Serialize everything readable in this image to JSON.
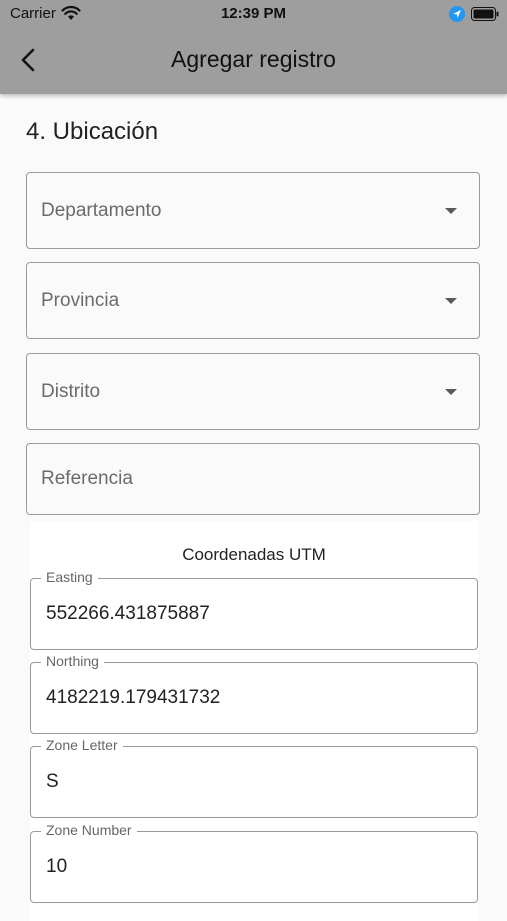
{
  "status_bar": {
    "carrier": "Carrier",
    "time": "12:39 PM"
  },
  "app_bar": {
    "title": "Agregar registro"
  },
  "section": {
    "title": "4. Ubicación"
  },
  "selects": {
    "departamento": "Departamento",
    "provincia": "Provincia",
    "distrito": "Distrito"
  },
  "referencia": {
    "placeholder": "Referencia"
  },
  "utm": {
    "title": "Coordenadas UTM",
    "easting": {
      "label": "Easting",
      "value": "552266.431875887"
    },
    "northing": {
      "label": "Northing",
      "value": "4182219.179431732"
    },
    "zone_letter": {
      "label": "Zone Letter",
      "value": "S"
    },
    "zone_number": {
      "label": "Zone Number",
      "value": "10"
    }
  },
  "colors": {
    "header": "#9e9e9e",
    "background": "#fafafa",
    "border": "#9a9a9a",
    "location_accent": "#2196f3"
  },
  "icons": {
    "back": "chevron-left-icon",
    "wifi": "wifi-icon",
    "location": "location-arrow-icon",
    "battery": "battery-icon",
    "dropdown": "caret-down-icon"
  }
}
